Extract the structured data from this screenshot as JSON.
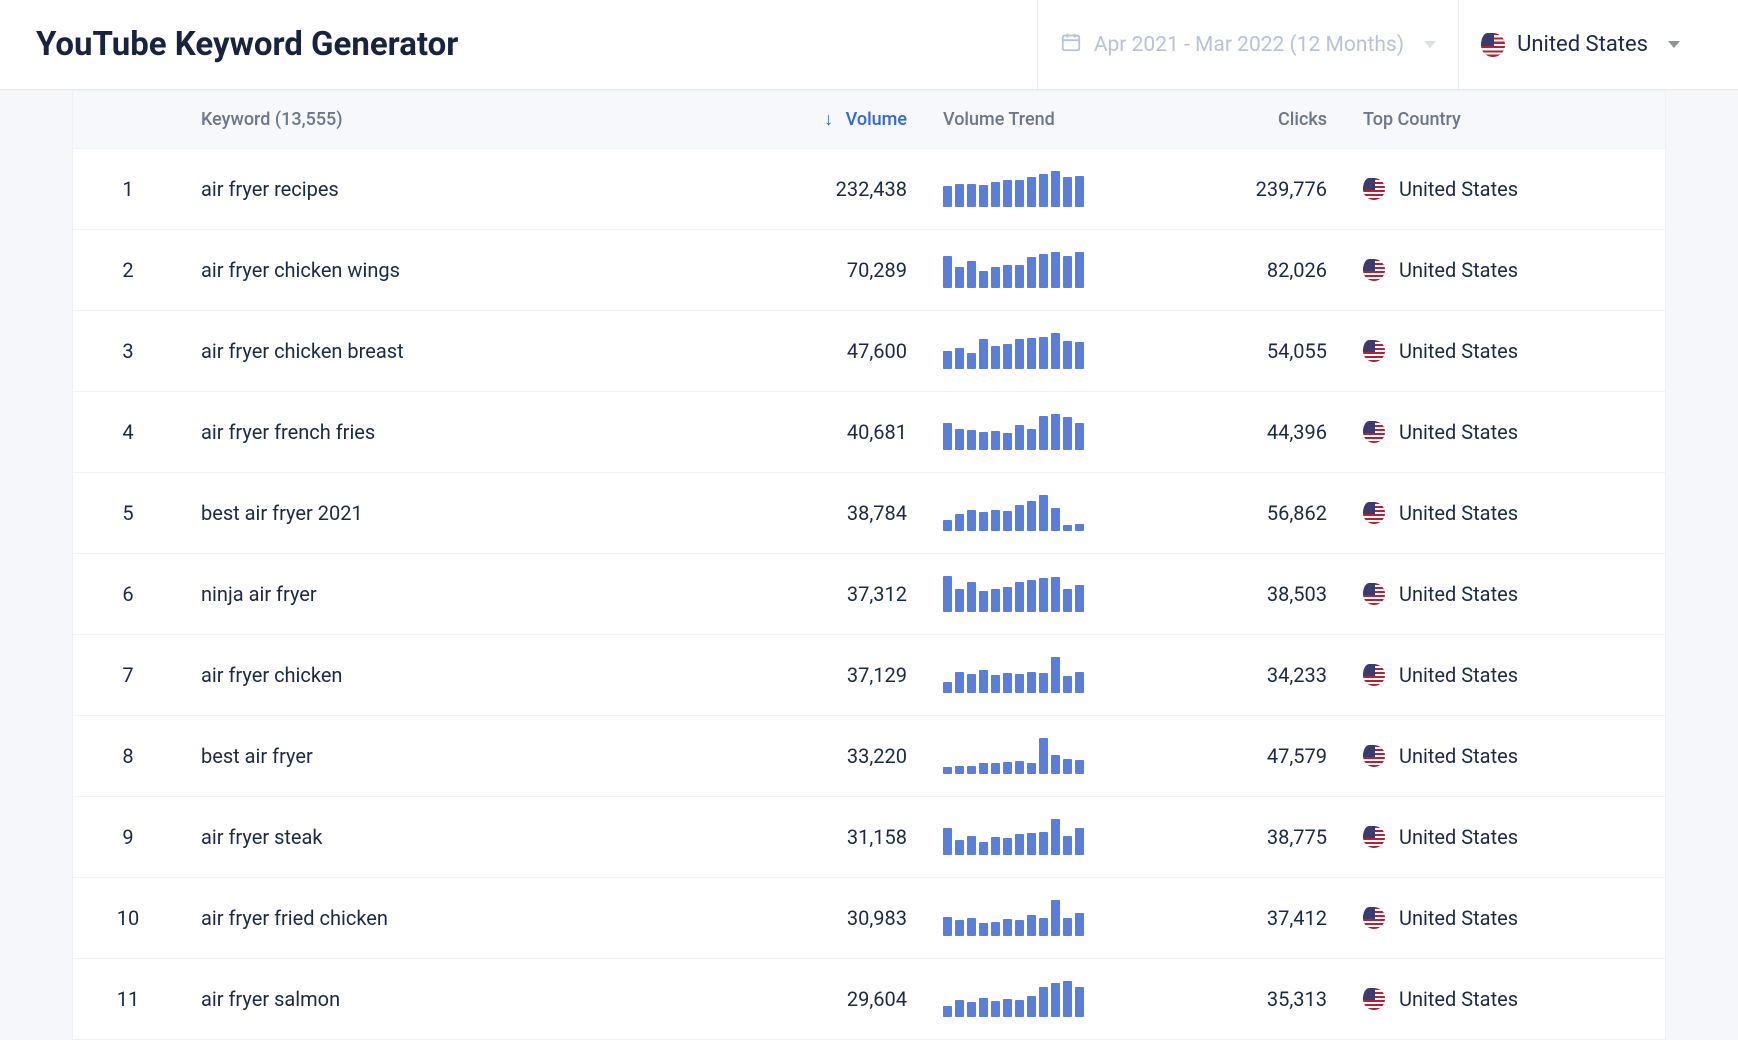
{
  "header": {
    "title": "YouTube Keyword Generator",
    "date_range": "Apr 2021 - Mar 2022 (12 Months)",
    "country": "United States"
  },
  "columns": {
    "rank": "",
    "keyword": "Keyword (13,555)",
    "volume": "Volume",
    "trend": "Volume Trend",
    "clicks": "Clicks",
    "top_country": "Top Country"
  },
  "rows": [
    {
      "rank": "1",
      "keyword": "air fryer recipes",
      "volume": "232,438",
      "clicks": "239,776",
      "country": "United States",
      "trend": [
        55,
        60,
        62,
        58,
        65,
        70,
        72,
        80,
        88,
        95,
        80,
        82
      ]
    },
    {
      "rank": "2",
      "keyword": "air fryer chicken wings",
      "volume": "70,289",
      "clicks": "82,026",
      "country": "United States",
      "trend": [
        85,
        55,
        70,
        45,
        55,
        60,
        62,
        82,
        90,
        95,
        85,
        95
      ]
    },
    {
      "rank": "3",
      "keyword": "air fryer chicken breast",
      "volume": "47,600",
      "clicks": "54,055",
      "country": "United States",
      "trend": [
        48,
        55,
        42,
        80,
        60,
        65,
        80,
        82,
        85,
        95,
        75,
        72
      ]
    },
    {
      "rank": "4",
      "keyword": "air fryer french fries",
      "volume": "40,681",
      "clicks": "44,396",
      "country": "United States",
      "trend": [
        70,
        55,
        52,
        48,
        50,
        45,
        65,
        55,
        90,
        95,
        88,
        70
      ]
    },
    {
      "rank": "5",
      "keyword": "best air fryer 2021",
      "volume": "38,784",
      "clicks": "56,862",
      "country": "United States",
      "trend": [
        30,
        45,
        55,
        50,
        55,
        52,
        68,
        78,
        95,
        60,
        15,
        18
      ]
    },
    {
      "rank": "6",
      "keyword": "ninja air fryer",
      "volume": "37,312",
      "clicks": "38,503",
      "country": "United States",
      "trend": [
        95,
        60,
        80,
        55,
        60,
        65,
        80,
        85,
        90,
        92,
        60,
        70
      ]
    },
    {
      "rank": "7",
      "keyword": "air fryer chicken",
      "volume": "37,129",
      "clicks": "34,233",
      "country": "United States",
      "trend": [
        30,
        55,
        50,
        60,
        48,
        52,
        50,
        55,
        52,
        95,
        45,
        55
      ]
    },
    {
      "rank": "8",
      "keyword": "best air fryer",
      "volume": "33,220",
      "clicks": "47,579",
      "country": "United States",
      "trend": [
        18,
        22,
        20,
        30,
        28,
        32,
        34,
        30,
        95,
        50,
        40,
        38
      ]
    },
    {
      "rank": "9",
      "keyword": "air fryer steak",
      "volume": "31,158",
      "clicks": "38,775",
      "country": "United States",
      "trend": [
        70,
        40,
        50,
        35,
        48,
        45,
        55,
        58,
        60,
        95,
        50,
        72
      ]
    },
    {
      "rank": "10",
      "keyword": "air fryer fried chicken",
      "volume": "30,983",
      "clicks": "37,412",
      "country": "United States",
      "trend": [
        50,
        42,
        48,
        35,
        38,
        45,
        42,
        55,
        48,
        95,
        48,
        62
      ]
    },
    {
      "rank": "11",
      "keyword": "air fryer salmon",
      "volume": "29,604",
      "clicks": "35,313",
      "country": "United States",
      "trend": [
        30,
        45,
        40,
        50,
        42,
        48,
        45,
        55,
        80,
        90,
        95,
        78
      ]
    }
  ]
}
